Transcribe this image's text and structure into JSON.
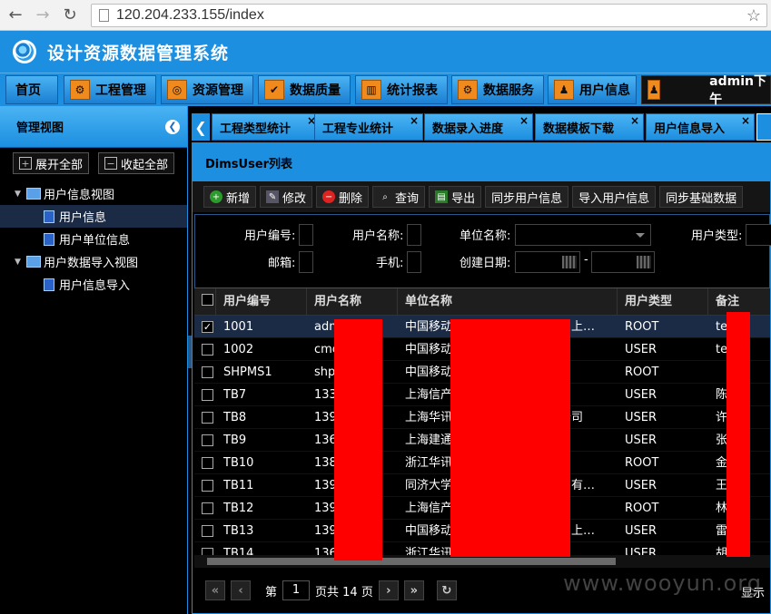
{
  "browser": {
    "url": "120.204.233.155/index"
  },
  "app": {
    "title": "设计资源数据管理系统",
    "user_display": "admin下午"
  },
  "menu": {
    "home": "首页",
    "items": [
      "工程管理",
      "资源管理",
      "数据质量",
      "统计报表",
      "数据服务",
      "用户信息"
    ]
  },
  "left_panel": {
    "title": "管理视图",
    "expand_all": "展开全部",
    "collapse_all": "收起全部",
    "tree": [
      {
        "label": "用户信息视图"
      },
      {
        "label": "用户信息"
      },
      {
        "label": "用户单位信息"
      },
      {
        "label": "用户数据导入视图"
      },
      {
        "label": "用户信息导入"
      }
    ]
  },
  "tabs": [
    "工程类型统计",
    "工程专业统计",
    "数据录入进度",
    "数据模板下载",
    "用户信息导入"
  ],
  "content": {
    "title": "DimsUser列表",
    "toolbar": [
      "新增",
      "修改",
      "删除",
      "查询",
      "导出",
      "同步用户信息",
      "导入用户信息",
      "同步基础数据"
    ],
    "form": {
      "user_code": "用户编号:",
      "user_name": "用户名称:",
      "unit_name": "单位名称:",
      "user_type": "用户类型:",
      "email": "邮箱:",
      "mobile": "手机:",
      "created": "创建日期:",
      "date_sep": "-"
    },
    "columns": [
      "用户编号",
      "用户名称",
      "单位名称",
      "用户类型",
      "备注"
    ],
    "rows": [
      {
        "code": "1001",
        "name": "adm",
        "unit": "中国移动",
        "unit2": "司上…",
        "type": "ROOT",
        "note": "te"
      },
      {
        "code": "1002",
        "name": "cmc",
        "unit": "中国移动",
        "unit2": "",
        "type": "USER",
        "note": "te"
      },
      {
        "code": "SHPMS1",
        "name": "shp",
        "unit": "中国移动",
        "unit2": "",
        "type": "ROOT",
        "note": ""
      },
      {
        "code": "TB7",
        "name": "133",
        "unit": "上海信产",
        "unit2": "",
        "type": "USER",
        "note": "陈"
      },
      {
        "code": "TB8",
        "name": "139",
        "unit": "上海华讯",
        "unit2": "公司",
        "type": "USER",
        "note": "许"
      },
      {
        "code": "TB9",
        "name": "136",
        "unit": "上海建通",
        "unit2": "",
        "type": "USER",
        "note": "张"
      },
      {
        "code": "TB10",
        "name": "138",
        "unit": "浙江华讯",
        "unit2": "",
        "type": "ROOT",
        "note": "金"
      },
      {
        "code": "TB11",
        "name": "139",
        "unit": "同济大学",
        "unit2": "）有…",
        "type": "USER",
        "note": "王"
      },
      {
        "code": "TB12",
        "name": "139",
        "unit": "上海信产",
        "unit2": "",
        "type": "ROOT",
        "note": "林"
      },
      {
        "code": "TB13",
        "name": "139",
        "unit": "中国移动",
        "unit2": "司上…",
        "type": "USER",
        "note": "雷"
      },
      {
        "code": "TB14",
        "name": "136",
        "unit": "浙江华讯",
        "unit2": "",
        "type": "USER",
        "note": "胡"
      }
    ],
    "pager": {
      "page_prefix": "第",
      "page": "1",
      "page_total": "页共 14 页",
      "display": "显示"
    }
  },
  "watermark": "www.wooyun.org"
}
